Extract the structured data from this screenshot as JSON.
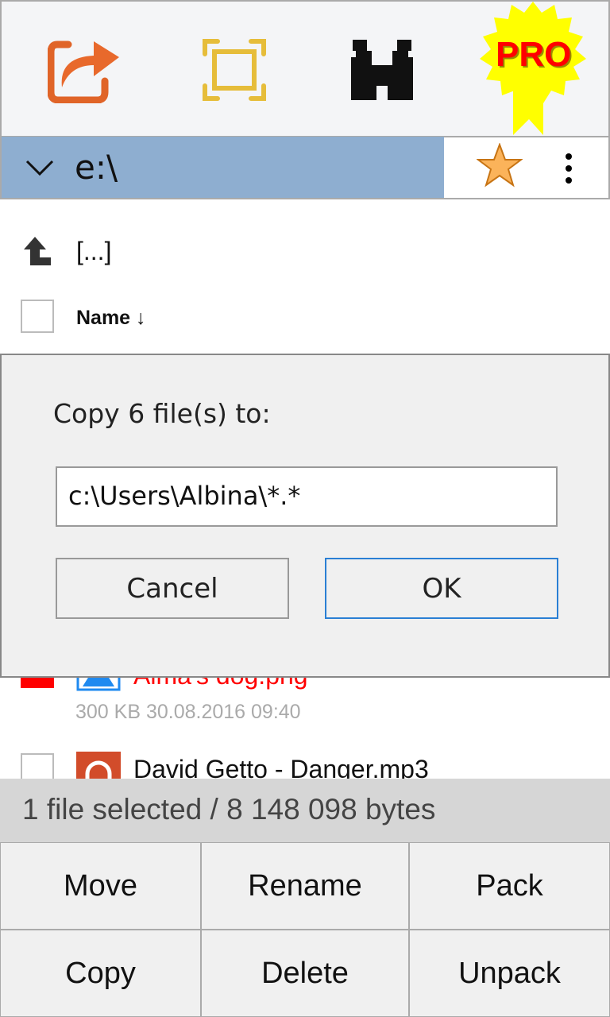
{
  "toolbar": {
    "icons": [
      "share-icon",
      "fullscreen-icon",
      "binoculars-icon"
    ],
    "pro_badge": "PRO"
  },
  "path": {
    "current": "e:\\"
  },
  "list": {
    "up_label": "[...]",
    "header_name": "Name ↓",
    "items": [
      {
        "name": "Alma's dog.png",
        "meta": "300 KB 30.08.2016 09:40",
        "selected": true,
        "icon": "image-icon"
      },
      {
        "name": "David Getto - Danger.mp3",
        "selected": false,
        "icon": "music-icon"
      }
    ]
  },
  "dialog": {
    "title": "Copy 6 file(s) to:",
    "target_value": "c:\\Users\\Albina\\*.*",
    "cancel_label": "Cancel",
    "ok_label": "OK"
  },
  "status": {
    "text": "1 file selected / 8 148 098 bytes"
  },
  "actions": [
    "Move",
    "Rename",
    "Pack",
    "Copy",
    "Delete",
    "Unpack"
  ],
  "colors": {
    "path_bar": "#8eaed0",
    "selected_text": "#ff0000",
    "ok_border": "#2a7fd4"
  }
}
